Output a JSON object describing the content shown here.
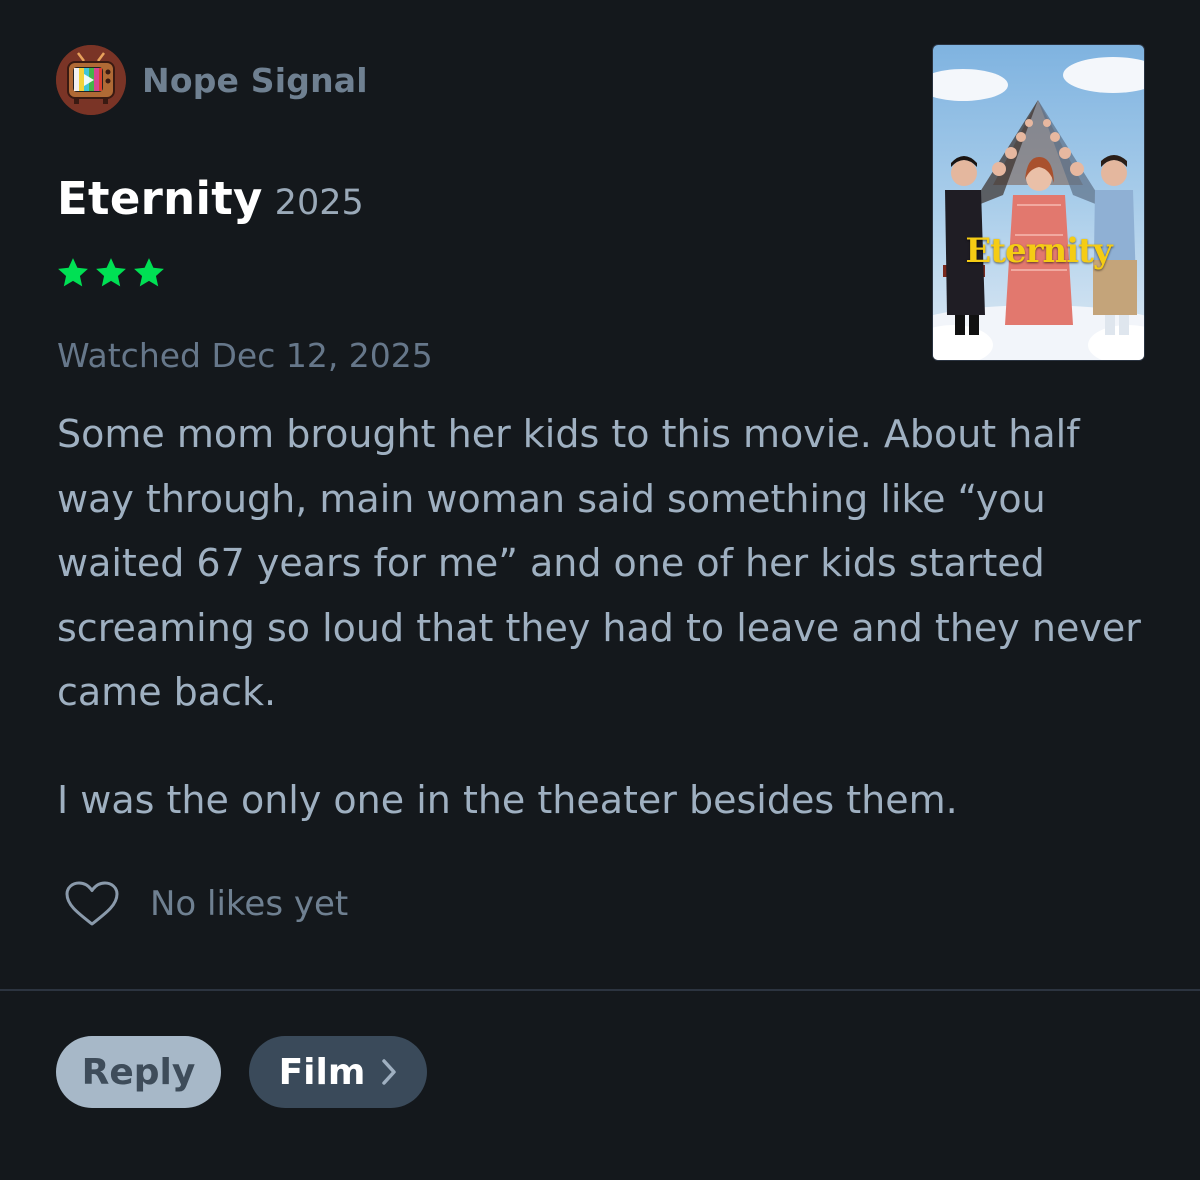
{
  "author": {
    "name": "Nope Signal",
    "avatar_icon": "retro-tv-icon"
  },
  "film": {
    "title": "Eternity",
    "year": "2025",
    "poster_title": "Eternity"
  },
  "rating": {
    "stars": 3,
    "max": 5,
    "color": "#00e054"
  },
  "watched": "Watched Dec 12, 2025",
  "review": {
    "paragraphs": [
      "Some mom brought her kids to this movie. About half way through, main woman said something like “you waited 67 years for me” and one of her kids started screaming so loud that they had to leave and they never came back.",
      "I was the only one in the theater besides them."
    ]
  },
  "likes": {
    "icon": "heart-outline-icon",
    "text": "No likes yet"
  },
  "actions": {
    "reply_label": "Reply",
    "film_label": "Film",
    "film_icon": "chevron-right-icon"
  },
  "colors": {
    "background": "#14181c",
    "reply_button": "#a7b8c8",
    "film_button": "#3a4a5a"
  }
}
